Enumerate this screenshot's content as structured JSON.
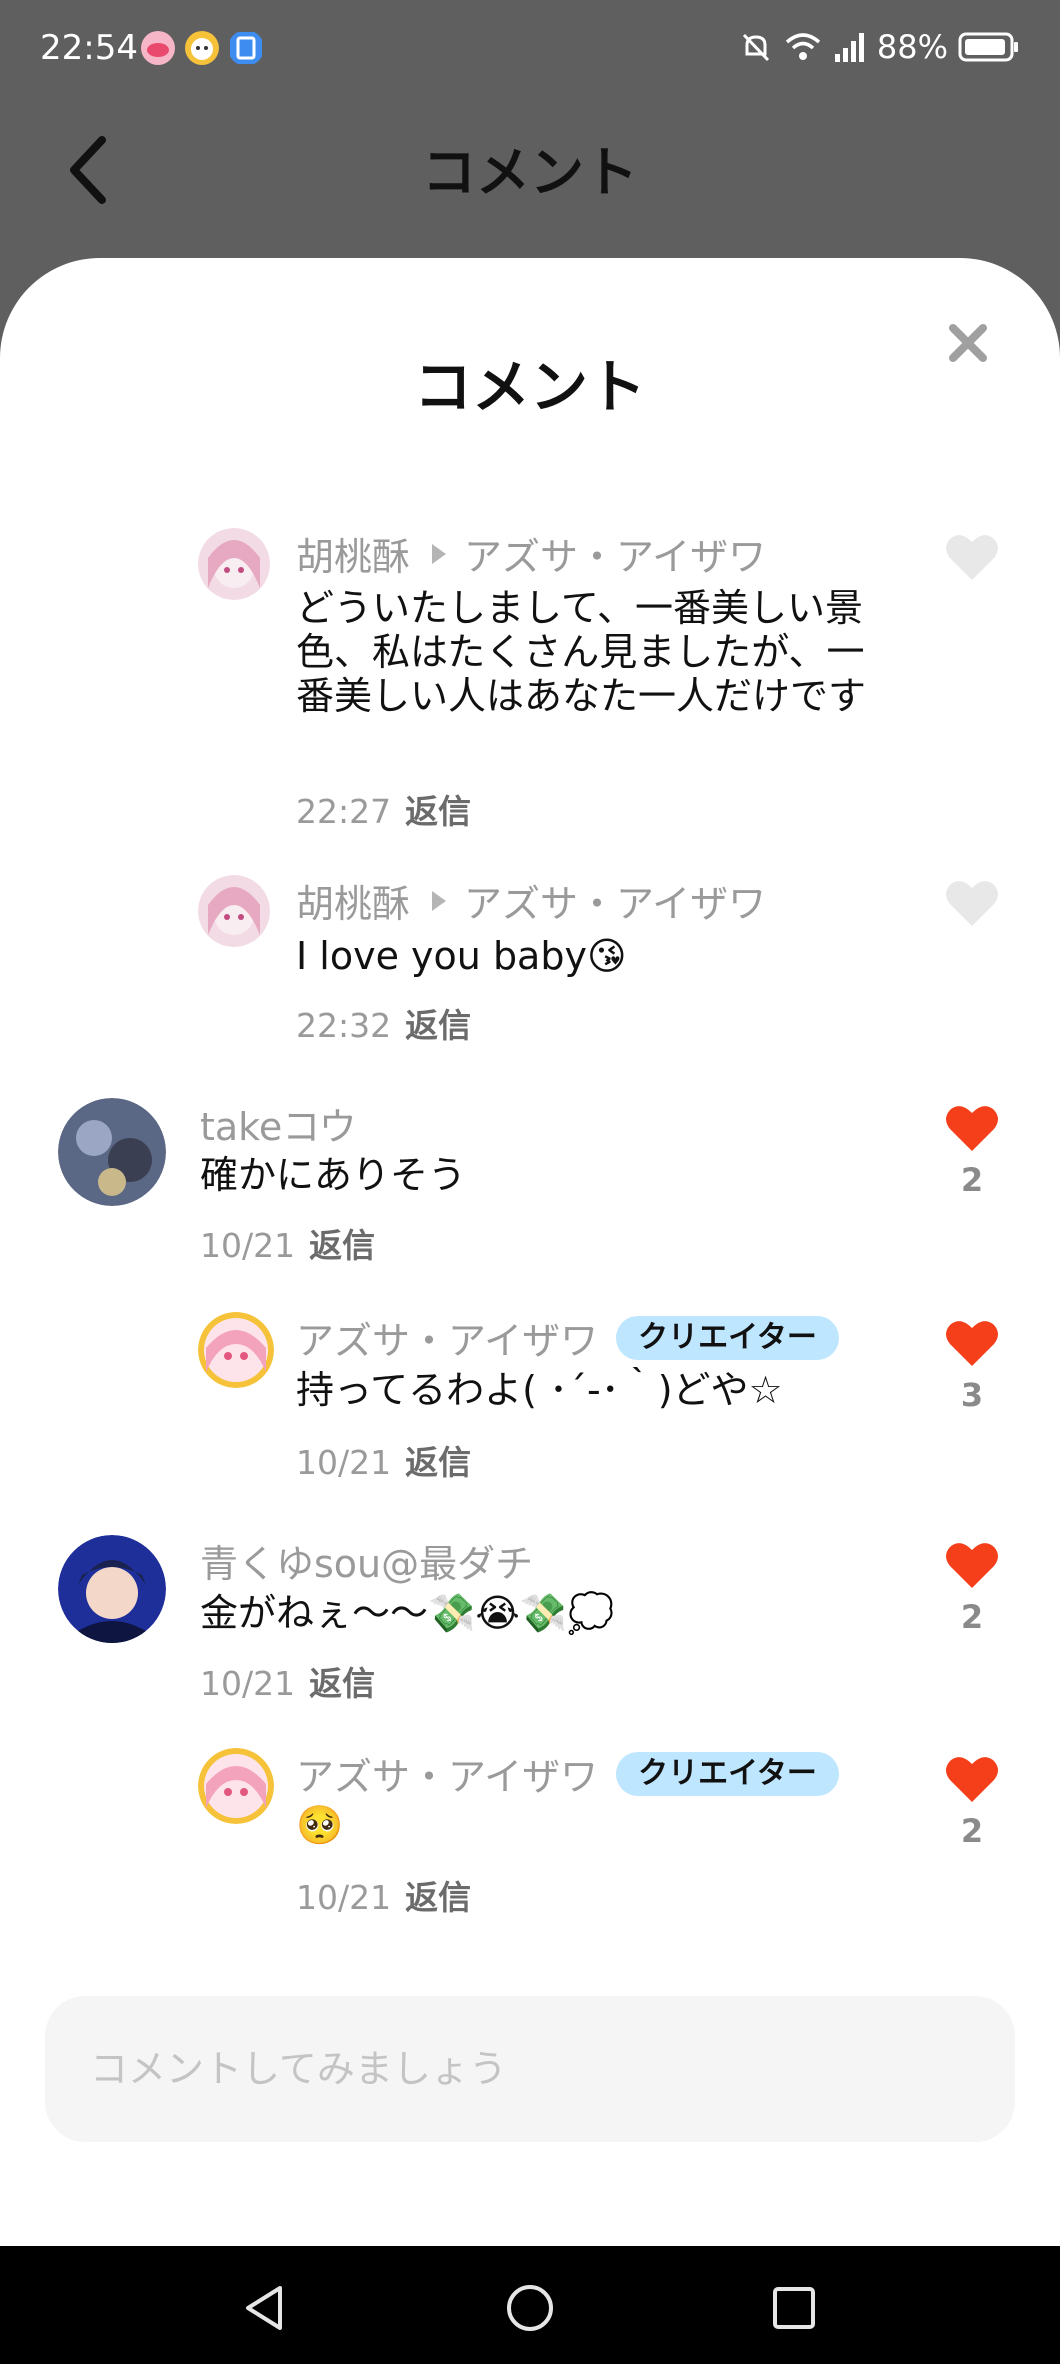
{
  "status": {
    "time": "22:54",
    "battery": "88%"
  },
  "header": {
    "title": "コメント"
  },
  "sheet": {
    "title": "コメント"
  },
  "comments": [
    {
      "author": "胡桃酥",
      "reply_to": "アズサ・アイザワ",
      "text": "どういたしまして、一番美しい景色、私はたくさん見ましたが、一番美しい人はあなた一人だけです",
      "time": "22:27",
      "reply_label": "返信"
    },
    {
      "author": "胡桃酥",
      "reply_to": "アズサ・アイザワ",
      "text": "I love you baby😘",
      "time": "22:32",
      "reply_label": "返信"
    },
    {
      "author": "takeコウ",
      "text": "確かにありそう",
      "time": "10/21",
      "reply_label": "返信",
      "likes": "2"
    },
    {
      "author": "アズサ・アイザワ",
      "badge": "クリエイター",
      "text": "持ってるわよ( ･´-･｀)どや☆",
      "time": "10/21",
      "reply_label": "返信",
      "likes": "3"
    },
    {
      "author": "青くゆsou@最ダチ",
      "text": "金がねぇ〜〜💸😭💸💭",
      "time": "10/21",
      "reply_label": "返信",
      "likes": "2"
    },
    {
      "author": "アズサ・アイザワ",
      "badge": "クリエイター",
      "text": "🥺",
      "time": "10/21",
      "reply_label": "返信",
      "likes": "2"
    }
  ],
  "input": {
    "placeholder": "コメントしてみましょう"
  },
  "colors": {
    "like_active": "#f43f1a",
    "like_inactive": "#e8e8e8",
    "badge_bg": "#bfe6ff"
  }
}
